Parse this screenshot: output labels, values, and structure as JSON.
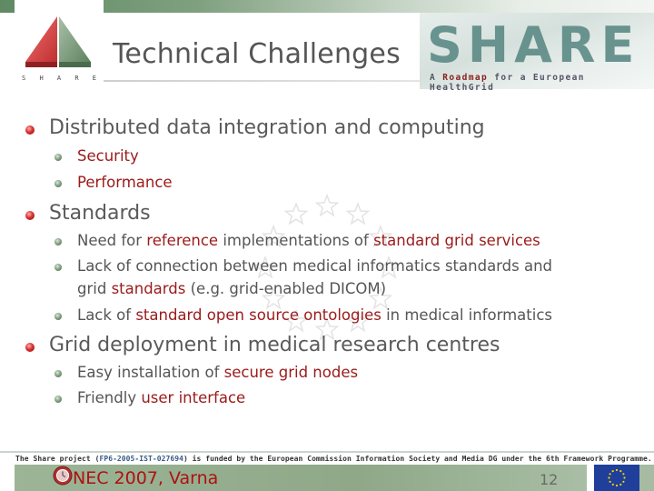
{
  "header": {
    "title": "Technical Challenges",
    "logo_letters": [
      "S",
      "H",
      "A",
      "R",
      "E"
    ],
    "banner": {
      "word": "SHARE",
      "tagline_prefix": "A ",
      "tagline_highlight": "Roadmap",
      "tagline_suffix": " for a European HealthGrid"
    }
  },
  "bullets": [
    {
      "text": [
        {
          "t": "Distributed data integration and computing",
          "red": false
        }
      ],
      "children": [
        [
          {
            "t": "Security",
            "red": true
          }
        ],
        [
          {
            "t": "Performance",
            "red": true
          }
        ]
      ]
    },
    {
      "text": [
        {
          "t": "Standards",
          "red": false
        }
      ],
      "children": [
        [
          {
            "t": "Need for ",
            "red": false
          },
          {
            "t": "reference",
            "red": true
          },
          {
            "t": " implementations of ",
            "red": false
          },
          {
            "t": "standard grid services",
            "red": true
          }
        ],
        [
          {
            "t": "Lack of connection between medical informatics standards and",
            "red": false
          }
        ],
        [
          {
            "t": "Lack of ",
            "red": false
          },
          {
            "t": "standard open source ontologies",
            "red": true
          },
          {
            "t": " in medical informatics",
            "red": false
          }
        ]
      ],
      "continuation": [
        {
          "t": "grid ",
          "red": false
        },
        {
          "t": "standards",
          "red": true
        },
        {
          "t": " (e.g. grid-enabled DICOM)",
          "red": false
        }
      ]
    },
    {
      "text": [
        {
          "t": "Grid deployment in medical research centres",
          "red": false
        }
      ],
      "children": [
        [
          {
            "t": "Easy installation of ",
            "red": false
          },
          {
            "t": "secure grid nodes",
            "red": true
          }
        ],
        [
          {
            "t": "Friendly ",
            "red": false
          },
          {
            "t": "user interface",
            "red": true
          }
        ]
      ]
    }
  ],
  "footer": {
    "funding_prefix": "The Share project (",
    "funding_project": "FP6-2005-IST-027694",
    "funding_suffix": ") is funded by the European Commission Information Society and Media DG under the 6th Framework Programme.",
    "event": "NEC 2007, Varna",
    "page_number": "12"
  },
  "colors": {
    "highlight": "#9b1a1a",
    "body_text": "#555555",
    "footer_bar": "#9cb597",
    "eu_blue": "#1f3f9a"
  }
}
